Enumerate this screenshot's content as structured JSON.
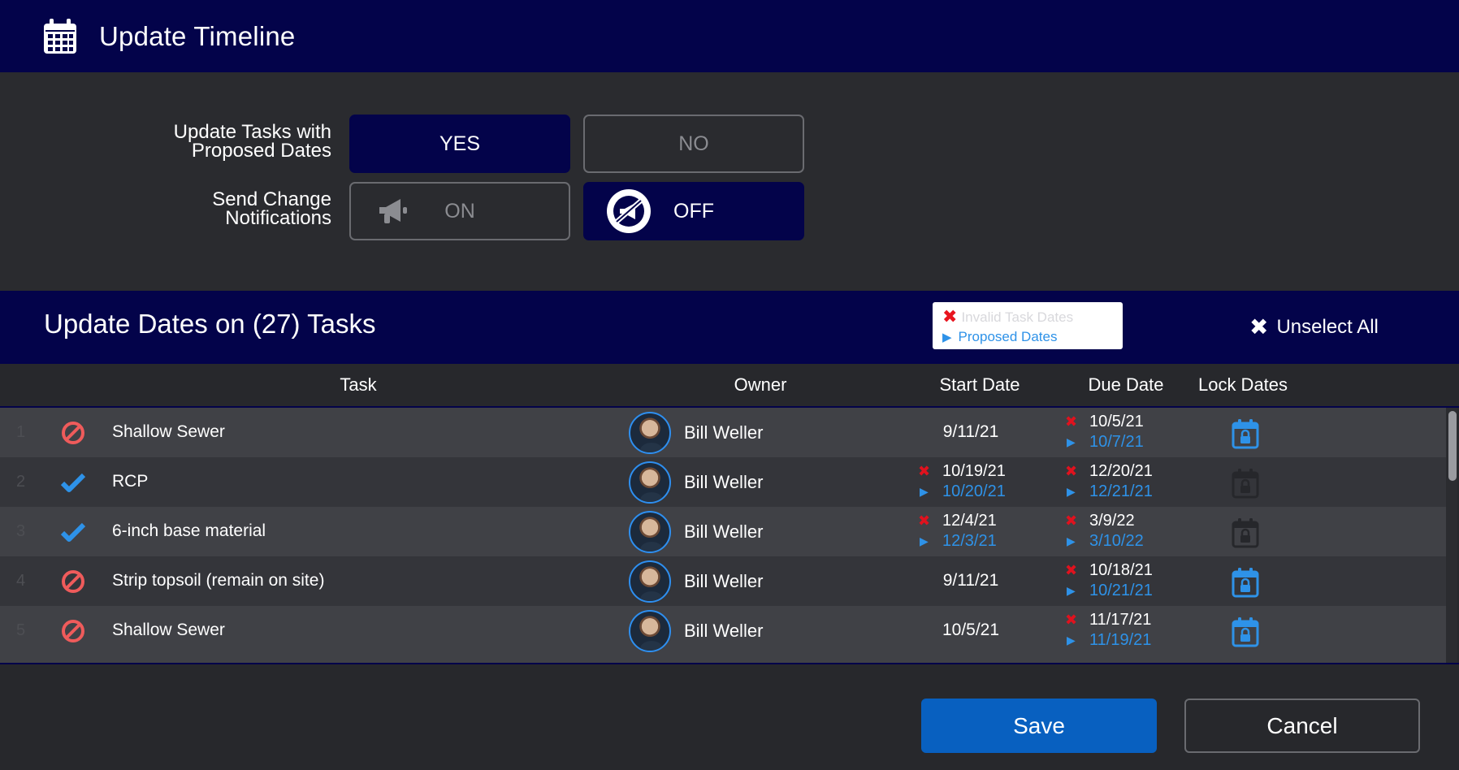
{
  "header": {
    "title": "Update Timeline",
    "icon": "calendar-icon"
  },
  "options": {
    "update_tasks": {
      "label_line1": "Update Tasks with",
      "label_line2": "Proposed Dates",
      "yes": "YES",
      "no": "NO",
      "selected": "YES"
    },
    "notifications": {
      "label_line1": "Send Change",
      "label_line2": "Notifications",
      "on": "ON",
      "off": "OFF",
      "selected": "OFF"
    }
  },
  "tasks_bar": {
    "title": "Update Dates on (27) Tasks",
    "legend": {
      "invalid": "Invalid Task Dates",
      "proposed": "Proposed Dates"
    },
    "unselect_all": "Unselect All"
  },
  "columns": {
    "task": "Task",
    "owner": "Owner",
    "start": "Start Date",
    "due": "Due Date",
    "lock": "Lock Dates"
  },
  "rows": [
    {
      "num": "1",
      "status": "blocked",
      "task": "Shallow Sewer",
      "owner": "Bill Weller",
      "start": "9/11/21",
      "due": "10/5/21",
      "due_proposed": "10/7/21",
      "lock": "active"
    },
    {
      "num": "2",
      "status": "check",
      "task": "RCP",
      "owner": "Bill Weller",
      "start": "10/19/21",
      "start_proposed": "10/20/21",
      "due": "12/20/21",
      "due_proposed": "12/21/21",
      "lock": "inactive"
    },
    {
      "num": "3",
      "status": "check",
      "task": "6-inch base material",
      "owner": "Bill Weller",
      "start": "12/4/21",
      "start_proposed": "12/3/21",
      "due": "3/9/22",
      "due_proposed": "3/10/22",
      "lock": "inactive"
    },
    {
      "num": "4",
      "status": "blocked",
      "task": "Strip topsoil (remain on site)",
      "owner": "Bill Weller",
      "start": "9/11/21",
      "due": "10/18/21",
      "due_proposed": "10/21/21",
      "lock": "active"
    },
    {
      "num": "5",
      "status": "blocked",
      "task": "Shallow Sewer",
      "owner": "Bill Weller",
      "start": "10/5/21",
      "due": "11/17/21",
      "due_proposed": "11/19/21",
      "lock": "active"
    }
  ],
  "footer": {
    "save": "Save",
    "cancel": "Cancel"
  },
  "colors": {
    "navy": "#03034a",
    "accent_blue": "#2e92e8",
    "save_blue": "#0860c0",
    "error_red": "#e0121e",
    "blocked_red": "#ef5b5b"
  }
}
